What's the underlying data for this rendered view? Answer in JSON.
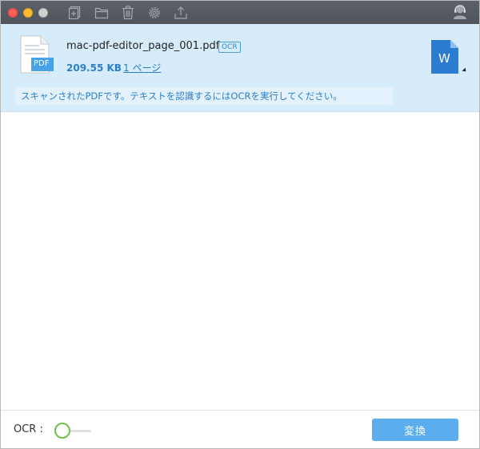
{
  "window": {
    "controls": [
      "close-icon",
      "minimize-icon",
      "maximize-icon"
    ]
  },
  "toolbar": {
    "icons": [
      "add-file-icon",
      "folder-icon",
      "trash-icon",
      "gear-icon",
      "upload-icon"
    ],
    "account_icon": "account-icon"
  },
  "file": {
    "name": "mac-pdf-editor_page_001.pdf",
    "badge": "OCR",
    "size": "209.55 KB",
    "pages": "1 ページ",
    "icon_label": "PDF",
    "output_format": "W",
    "scan_message": "スキャンされたPDFです。テキストを認識するにはOCRを実行してください。"
  },
  "footer": {
    "ocr_label": "OCR :",
    "convert_label": "変換"
  },
  "colors": {
    "accent": "#5aaeef",
    "selected_row": "#d6ecfb",
    "link": "#2a7fc7",
    "toggle": "#6cc24a",
    "word_blue": "#2b7bd0"
  }
}
